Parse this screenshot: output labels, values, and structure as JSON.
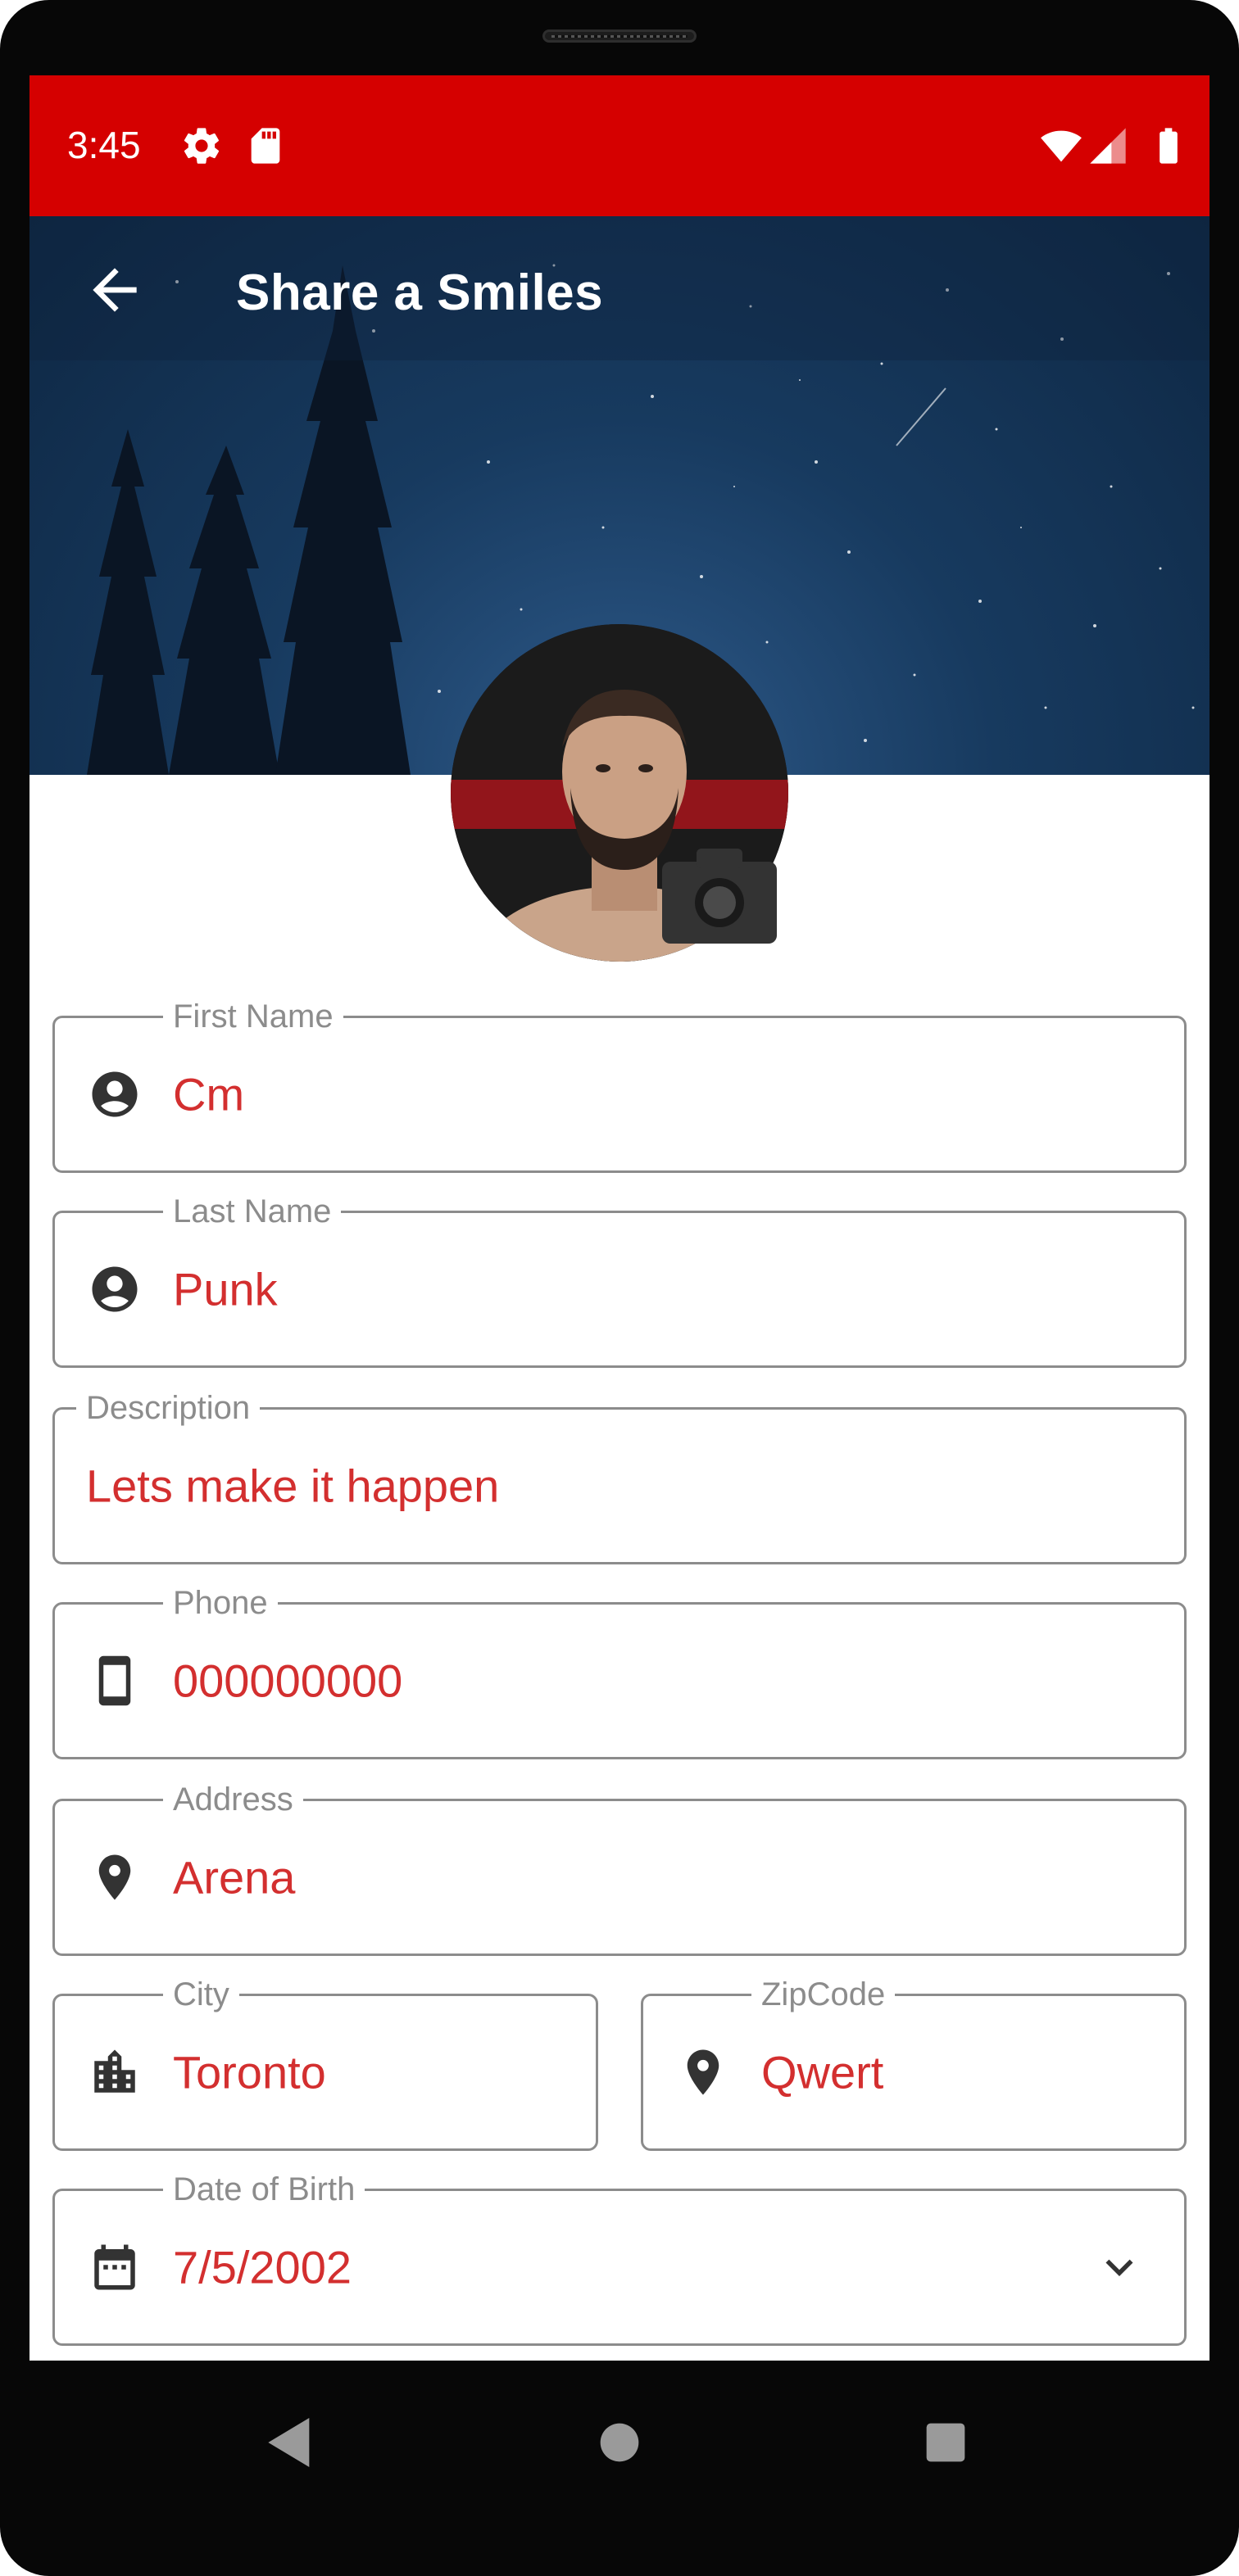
{
  "status_bar": {
    "time": "3:45",
    "icons": [
      "gear-icon",
      "sd-card-icon",
      "wifi-icon",
      "signal-icon",
      "battery-icon"
    ],
    "background": "#d50000"
  },
  "app_bar": {
    "title": "Share a Smiles",
    "back_icon": "arrow-back-icon"
  },
  "profile": {
    "avatar": "profile-photo",
    "camera_icon": "camera-icon"
  },
  "form": {
    "first_name": {
      "label": "First Name",
      "value": "Cm",
      "icon": "account-circle-icon"
    },
    "last_name": {
      "label": "Last Name",
      "value": "Punk",
      "icon": "account-circle-icon"
    },
    "description": {
      "label": "Description",
      "value": "Lets make it happen"
    },
    "phone": {
      "label": "Phone",
      "value": "000000000",
      "icon": "smartphone-icon"
    },
    "address": {
      "label": "Address",
      "value": "Arena",
      "icon": "location-pin-icon"
    },
    "city": {
      "label": "City",
      "value": "Toronto",
      "icon": "city-icon"
    },
    "zipcode": {
      "label": "ZipCode",
      "value": "Qwert",
      "icon": "location-pin-icon"
    },
    "dob": {
      "label": "Date of Birth",
      "value": "7/5/2002",
      "icon": "calendar-icon"
    }
  },
  "colors": {
    "accent": "#d32f2f",
    "outline": "#8c8c8c",
    "label": "#8c8c8c"
  },
  "nav": {
    "icons": [
      "back-triangle-icon",
      "home-circle-icon",
      "recents-square-icon"
    ]
  }
}
